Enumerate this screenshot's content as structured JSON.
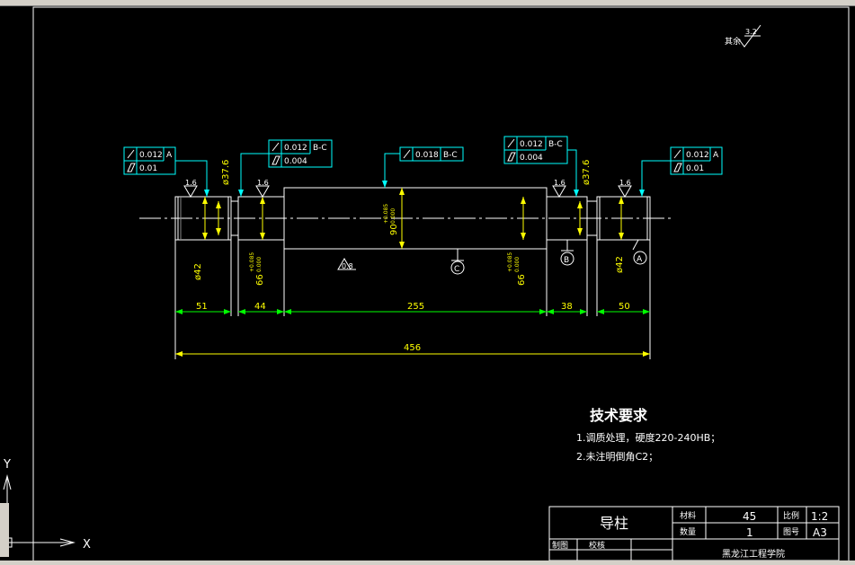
{
  "drawing": {
    "surface_finish_note": {
      "prefix": "其余",
      "value": "3.2"
    },
    "fcf": {
      "left_runout": "0.012",
      "left_runout_datum": "A",
      "left_cyl": "0.01",
      "mid_left_runout": "0.012",
      "mid_left_runout_datum": "B-C",
      "mid_left_cyl": "0.004",
      "center_runout": "0.018",
      "center_runout_datum": "B-C",
      "mid_right_runout": "0.012",
      "mid_right_runout_datum": "B-C",
      "mid_right_cyl": "0.004",
      "right_runout": "0.012",
      "right_runout_datum": "A",
      "right_cyl": "0.01"
    },
    "roughness": {
      "r1": "1.6",
      "r2": "1.6",
      "r3": "1.6",
      "r4": "1.6",
      "r5": "0.8"
    },
    "diameters": {
      "d_left_top": "ø37.6",
      "d_right_top": "ø37.6",
      "d_left_bottom": "ø42",
      "d_right_bottom": "ø42",
      "d_66_left": "66",
      "d_66_left_tol_up": "+0.085",
      "d_66_left_tol_low": "0.000",
      "d_90": "90",
      "d_90_tol_up": "+0.085",
      "d_90_tol_low": "0.000",
      "d_66_right": "66",
      "d_66_right_tol_up": "+0.085",
      "d_66_right_tol_low": "0.000"
    },
    "datums": {
      "a": "A",
      "b": "B",
      "c": "C"
    },
    "lengths": {
      "l1": "51",
      "l2": "44",
      "l3": "255",
      "l4": "38",
      "l5": "50",
      "total": "456"
    },
    "tech_requirements": {
      "title": "技术要求",
      "line1": "1.调质处理，硬度220-240HB；",
      "line2": "2.未注明倒角C2；"
    },
    "title_block": {
      "part_name": "导柱",
      "material_label": "材料",
      "material_value": "45",
      "qty_label": "数量",
      "qty_value": "1",
      "scale_label": "比例",
      "scale_value": "1:2",
      "sheet_label": "图号",
      "sheet_value": "A3",
      "drawn_label": "制图",
      "check_label": "校核",
      "school": "黑龙江工程学院"
    },
    "ucs": {
      "x": "X",
      "y": "Y"
    }
  },
  "colors": {
    "background": "#000000",
    "geometry": "#ffffff",
    "dimension": "#00ff00",
    "dimension_text": "#ffff00",
    "annotation": "#00ffff",
    "border": "#ffffff"
  }
}
